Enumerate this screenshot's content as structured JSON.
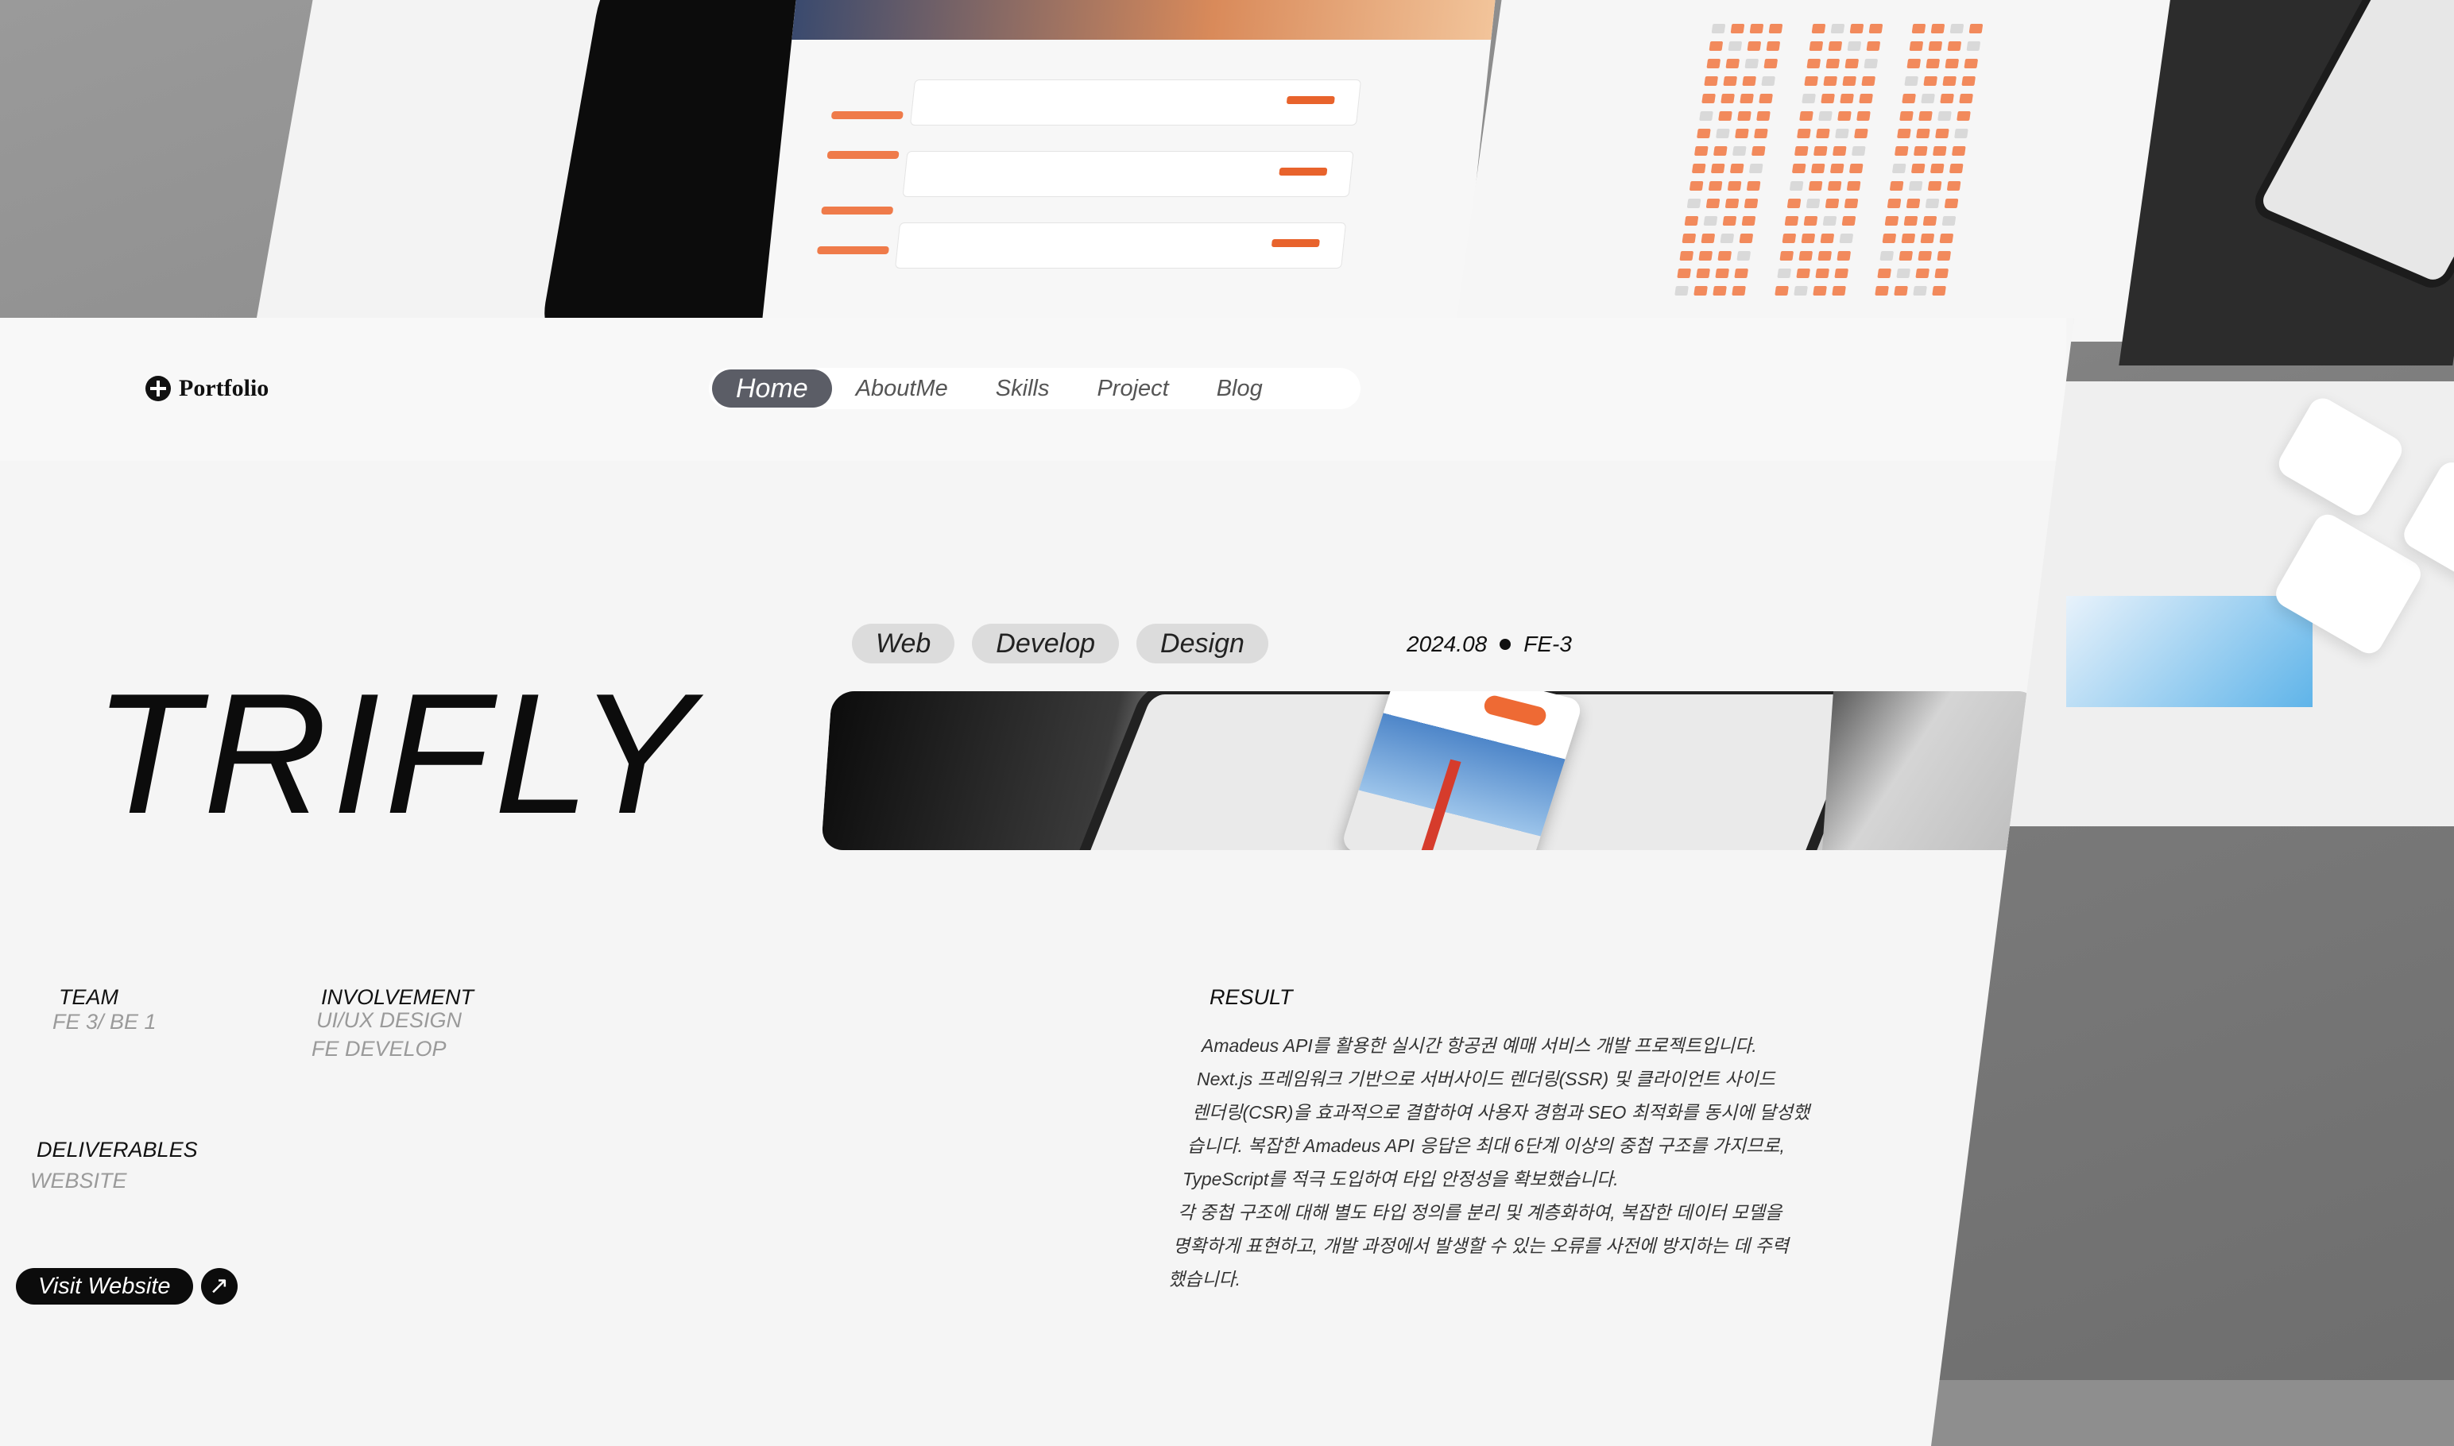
{
  "brand": {
    "logo_text": "Portfolio"
  },
  "nav": {
    "items": [
      "Home",
      "AboutMe",
      "Skills",
      "Project",
      "Blog"
    ],
    "active": "Home"
  },
  "project": {
    "tags": [
      "Web",
      "Develop",
      "Design"
    ],
    "date": "2024.08",
    "team_code": "FE-3",
    "title": "TRIFLY"
  },
  "details": {
    "team_label": "TEAM",
    "team_value": "FE 3/ BE 1",
    "involvement_label": "INVOLVEMENT",
    "involvement_values": [
      "UI/UX DESIGN",
      "FE DEVELOP"
    ],
    "deliverables_label": "DELIVERABLES",
    "deliverables_value": "WEBSITE"
  },
  "result": {
    "label": "RESULT",
    "lines": [
      "Amadeus API를 활용한 실시간 항공권 예매 서비스 개발 프로젝트입니다.",
      "Next.js 프레임워크 기반으로 서버사이드 렌더링(SSR) 및 클라이언트 사이드",
      "렌더링(CSR)을 효과적으로 결합하여 사용자 경험과 SEO 최적화를 동시에 달성했",
      "습니다. 복잡한 Amadeus API 응답은 최대 6단계 이상의 중첩 구조를 가지므로,",
      "TypeScript를 적극 도입하여 타입 안정성을 확보했습니다.",
      "각 중첩 구조에 대해 별도 타입 정의를 분리 및 계층화하여, 복잡한 데이터 모델을",
      "명확하게 표현하고, 개발 과정에서 발생할 수 있는 오류를 사전에 방지하는 데 주력",
      "했습니다."
    ]
  },
  "cta": {
    "visit_label": "Visit Website",
    "arrow_icon": "arrow-up-right-icon"
  },
  "colors": {
    "accent": "#ee6a34",
    "nav_active": "#5b5d66",
    "text": "#0c0c0c"
  }
}
